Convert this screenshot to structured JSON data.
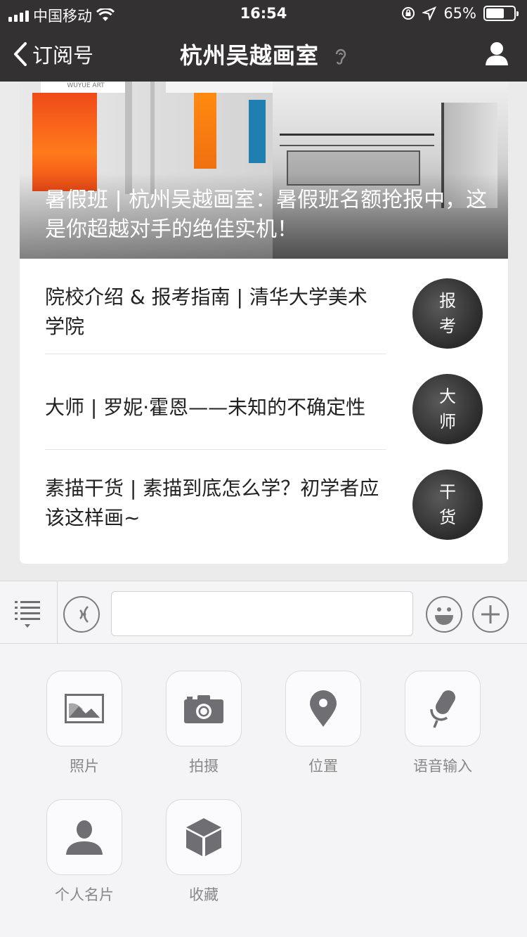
{
  "status_bar": {
    "carrier": "中国移动",
    "time": "16:54",
    "battery": "65%",
    "battery_level": 0.65
  },
  "nav": {
    "back_label": "订阅号",
    "title": "杭州吴越画室"
  },
  "hero": {
    "sign_text": "WUYUE ART",
    "title": "暑假班 | 杭州吴越画室：暑假班名额抢报中，这是你超越对手的绝佳实机！"
  },
  "articles": [
    {
      "title": "院校介绍 & 报考指南 | 清华大学美术学院",
      "thumb_line1": "报",
      "thumb_line2": "考"
    },
    {
      "title": "大师 | 罗妮·霍恩——未知的不确定性",
      "thumb_line1": "大",
      "thumb_line2": "师"
    },
    {
      "title": "素描干货 | 素描到底怎么学？初学者应该这样画~",
      "thumb_line1": "干",
      "thumb_line2": "货"
    }
  ],
  "tools": [
    {
      "label": "照片",
      "icon": "photo-icon"
    },
    {
      "label": "拍摄",
      "icon": "camera-icon"
    },
    {
      "label": "位置",
      "icon": "location-icon"
    },
    {
      "label": "语音输入",
      "icon": "microphone-icon"
    },
    {
      "label": "个人名片",
      "icon": "contact-card-icon"
    },
    {
      "label": "收藏",
      "icon": "favorites-box-icon"
    }
  ],
  "colors": {
    "nav_bg": "#333132",
    "icon_gray": "#7a7a7e"
  }
}
